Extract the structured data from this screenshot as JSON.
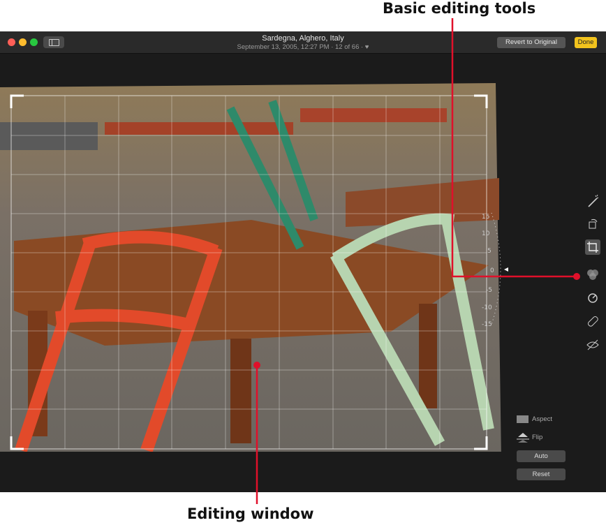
{
  "callouts": {
    "top": "Basic editing tools",
    "bottom": "Editing window"
  },
  "titlebar": {
    "title": "Sardegna, Alghero, Italy",
    "subtitle": "September 13, 2005, 12:27 PM  ·  12 of 66  ·  ♥"
  },
  "buttons": {
    "revert": "Revert to Original",
    "done": "Done"
  },
  "straighten_dial": {
    "labels": [
      "15",
      "10",
      "5",
      "0",
      "-5",
      "-10",
      "-15"
    ]
  },
  "crop_options": {
    "aspect": "Aspect",
    "flip": "Flip",
    "auto": "Auto",
    "reset": "Reset"
  },
  "tools": [
    "magic-wand-icon",
    "rotate-icon",
    "crop-icon",
    "filters-icon",
    "adjust-icon",
    "retouch-icon",
    "red-eye-icon"
  ],
  "colors": {
    "done": "#f2c31d",
    "callout_line": "#e0102a",
    "close": "#ff5f57",
    "minimize": "#febc2e",
    "zoom": "#28c840"
  }
}
